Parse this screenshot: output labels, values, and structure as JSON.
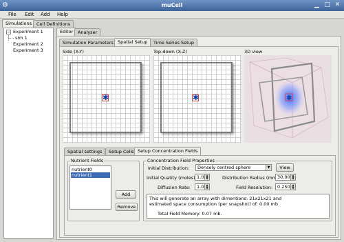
{
  "window": {
    "title": "muCell"
  },
  "menu": [
    "File",
    "Edit",
    "Add",
    "Help"
  ],
  "left_tabs": [
    "Simulations",
    "Cell Definitions"
  ],
  "tree": {
    "items": [
      {
        "label": "Experiment 1",
        "expanded": true
      },
      {
        "label": "sim 1"
      },
      {
        "label": "Experiment 2"
      },
      {
        "label": "Experiment 3"
      }
    ],
    "toggle": "−"
  },
  "main_tabs": [
    "Editor",
    "Analyser"
  ],
  "sub_tabs": [
    "Simulation Parameters",
    "Spatial Setup",
    "Time Series Setup"
  ],
  "views": {
    "side": "Side (X-Y)",
    "top": "Top-down  (X-Z)",
    "three_d": "3D view"
  },
  "bottom_tabs": [
    "Spatial settings",
    "Setup Cells",
    "Setup Concentration Fields"
  ],
  "nutrient_fields": {
    "title": "Nutrient Fields",
    "items": [
      "nutrient0",
      "nutrient1"
    ],
    "selected_index": 1,
    "add": "Add",
    "remove": "Remove"
  },
  "concentration": {
    "title": "Concentration Field Properties",
    "initial_distribution_label": "Initial Distribution:",
    "initial_distribution_value": "Densely centred sphere",
    "view_button": "View",
    "initial_quantity_label": "Initial Quatity (moles):",
    "initial_quantity_value": "1.000",
    "distribution_radius_label": "Distribution Radius (mm):",
    "distribution_radius_value": "30.00",
    "diffusion_rate_label": "Diffusion Rate:",
    "diffusion_rate_value": "1.000",
    "field_resolution_label": "Field Resolution:",
    "field_resolution_value": "0.250",
    "info_line1": "This will generate an array with dimentions: 21x21x21 and",
    "info_line2": "estimated space consumption (per snapshot) of: 0.00 mb",
    "info_line3": "Total Field Memory: 0.07 mb."
  },
  "colors": {
    "titlebar": "#4a72a9",
    "selection": "#3d6bb3",
    "cell_marker": "#1a3fa8",
    "cell_box": "#d04040"
  }
}
